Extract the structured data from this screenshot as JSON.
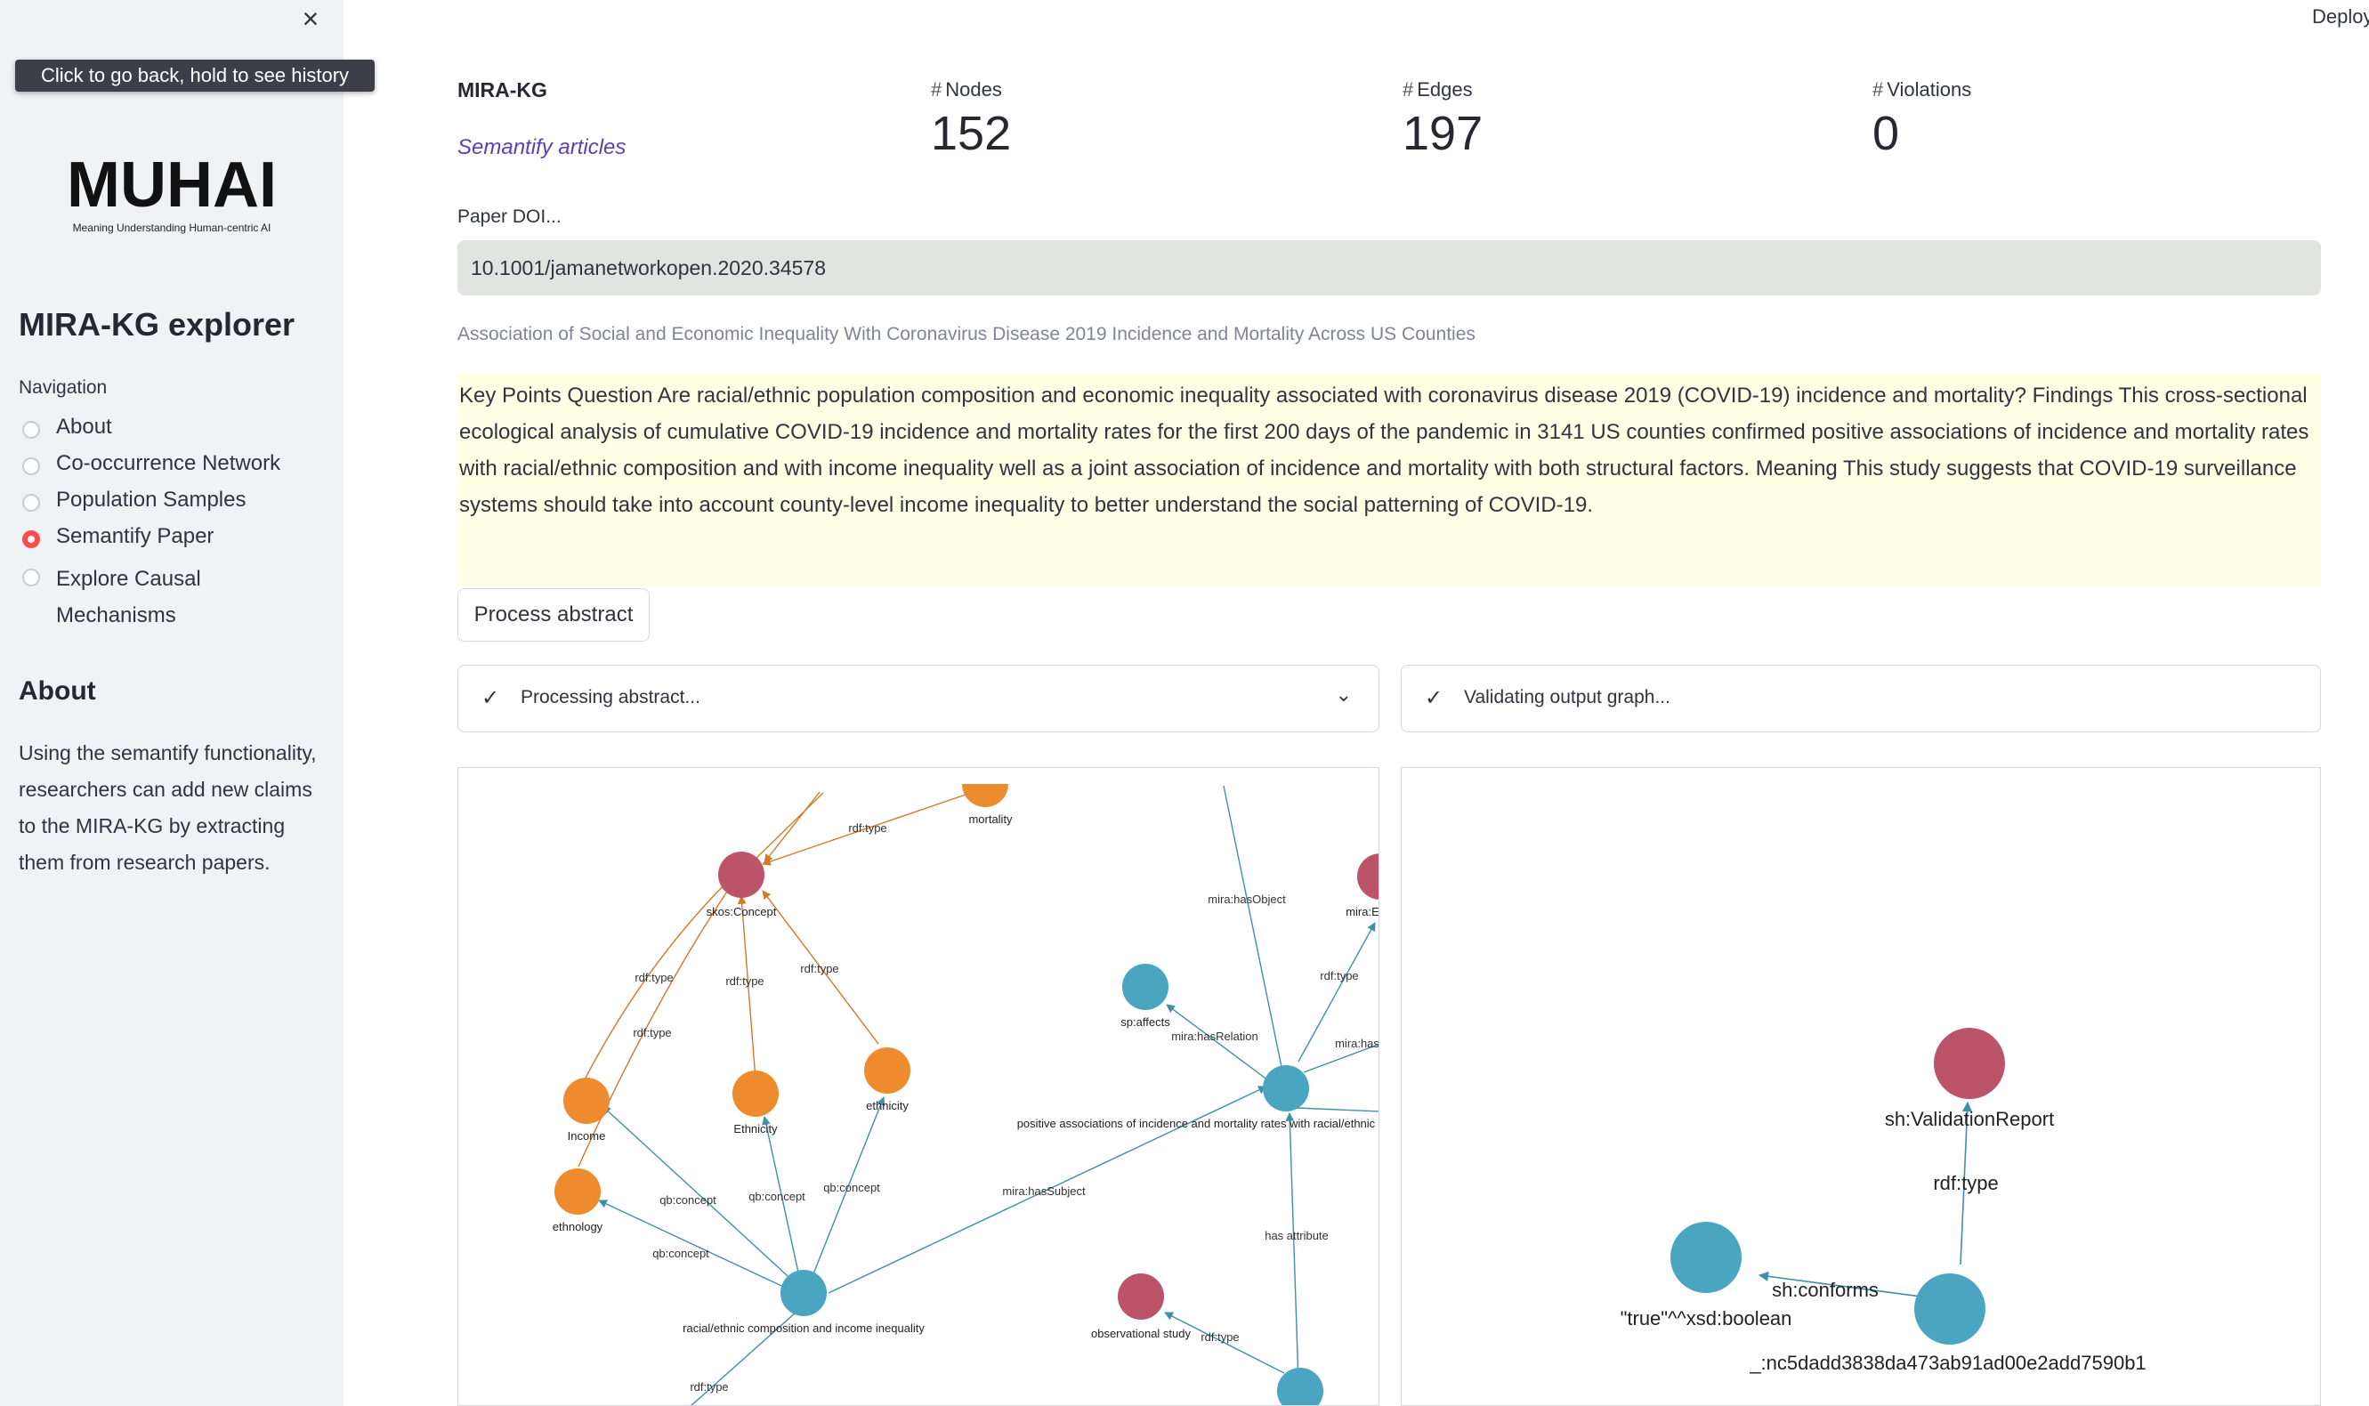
{
  "sidebar": {
    "tooltip": "Click to go back, hold to see history",
    "logo_text": "MUHAI",
    "logo_subtitle": "Meaning Understanding Human-centric AI",
    "app_title": "MIRA-KG explorer",
    "nav_label": "Navigation",
    "nav_items": [
      {
        "label": "About",
        "selected": false
      },
      {
        "label": "Co-occurrence Network",
        "selected": false
      },
      {
        "label": "Population Samples",
        "selected": false
      },
      {
        "label": "Semantify Paper",
        "selected": true
      },
      {
        "label": "Explore Causal Mechanisms",
        "selected": false
      }
    ],
    "about_heading": "About",
    "about_text": "Using the semantify functionality, researchers can add new claims to the MIRA-KG by extracting them from research papers."
  },
  "header": {
    "deploy": "Deploy"
  },
  "main": {
    "brand": "MIRA-KG",
    "link": "Semantify articles",
    "metrics": [
      {
        "label": "Nodes",
        "value": "152"
      },
      {
        "label": "Edges",
        "value": "197"
      },
      {
        "label": "Violations",
        "value": "0"
      }
    ],
    "doi_label": "Paper DOI...",
    "doi_value": "10.1001/jamanetworkopen.2020.34578",
    "paper_title": "Association of Social and Economic Inequality With Coronavirus Disease 2019 Incidence and Mortality Across US Counties",
    "abstract": "Key Points Question Are racial/ethnic population composition and economic inequality associated with coronavirus disease 2019 (COVID-19) incidence and mortality? Findings This cross-sectional ecological analysis of cumulative COVID-19 incidence and mortality rates for the first 200 days of the pandemic in 3141 US counties confirmed positive associations of incidence and mortality rates with racial/ethnic composition and with income inequality well as a joint association of incidence and mortality with both structural factors. Meaning This study suggests that COVID-19 surveillance systems should take into account county-level income inequality to better understand the social patterning of COVID-19.",
    "process_button": "Process abstract",
    "status_processing": "Processing abstract...",
    "status_validating": "Validating output graph..."
  },
  "colors": {
    "concept": "#bb5468",
    "orange": "#ee8b2e",
    "teal": "#4aa5c0",
    "accent": "#ff4b4b",
    "link": "#5b3fb3"
  },
  "graph_left": {
    "node_labels": {
      "concept": "skos:Concept",
      "mortality": "mortality",
      "income": "Income",
      "ethnicity_cap": "Ethnicity",
      "ethnicity": "ethnicity",
      "ethnology": "ethnology",
      "subject": "racial/ethnic composition and income inequality",
      "claim": "positive associations of incidence and mortality rates with racial/ethnic c",
      "affects": "sp:affects",
      "obs": "observational study",
      "mira_cut": "mira:E"
    },
    "edge_labels": {
      "rdftype": "rdf:type",
      "qbconcept": "qb:concept",
      "hasSubject": "mira:hasSubject",
      "hasObject": "mira:hasObject",
      "hasRelation": "mira:hasRelation",
      "mirahas": "mira:has",
      "hasattr": "has attribute"
    }
  },
  "graph_right": {
    "node_labels": {
      "report": "sh:ValidationReport",
      "bool": "\"true\"^^xsd:boolean",
      "bnode": "_:nc5dadd3838da473ab91ad00e2add7590b1"
    },
    "edge_labels": {
      "rdftype": "rdf:type",
      "conforms": "sh:conforms"
    }
  }
}
